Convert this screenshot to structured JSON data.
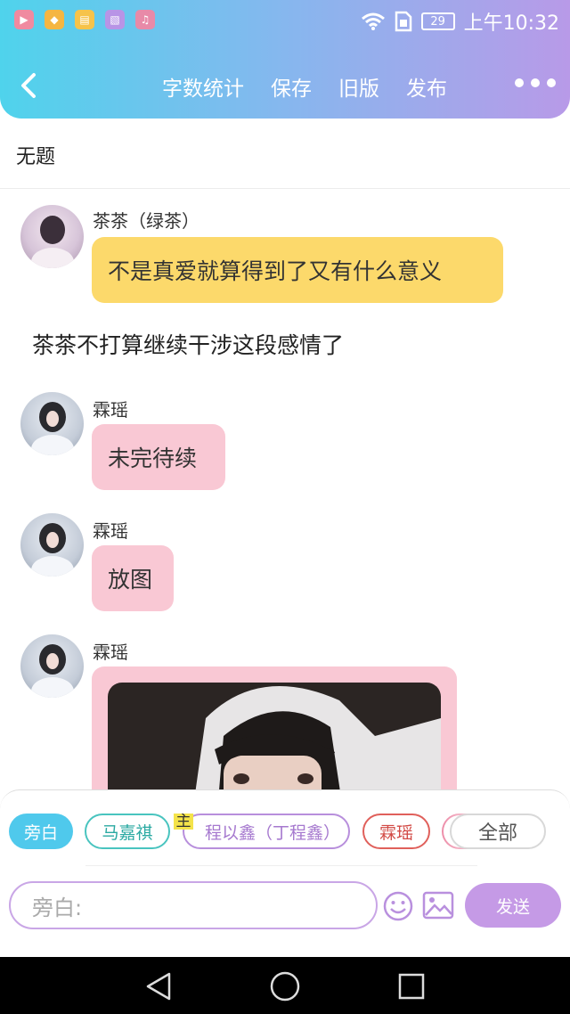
{
  "status": {
    "battery": "29",
    "time": "上午10:32"
  },
  "navbar": {
    "word_count": "字数统计",
    "save": "保存",
    "old_version": "旧版",
    "publish": "发布"
  },
  "doc": {
    "title": "无题"
  },
  "messages": [
    {
      "name": "茶茶（绿茶）",
      "text": "不是真爱就算得到了又有什么意义",
      "bubble_color": "#fcd96b"
    },
    {
      "narration": "茶茶不打算继续干涉这段感情了"
    },
    {
      "name": "霖瑶",
      "text": "未完待续",
      "bubble_color": "#f9c8d4"
    },
    {
      "name": "霖瑶",
      "text": "放图",
      "bubble_color": "#f9c8d4"
    },
    {
      "name": "霖瑶",
      "bubble_color": "#f9c8d4"
    }
  ],
  "roles": {
    "narrator": "旁白",
    "r1": "马嘉祺",
    "main_mark": "主",
    "r2": "程以鑫（丁程鑫）",
    "r3": "霖瑶",
    "all": "全部"
  },
  "input": {
    "placeholder": "旁白:",
    "send": "发送"
  },
  "colors": {
    "accent_purple": "#c59ae6",
    "teal": "#49c4bf",
    "red": "#e0605b",
    "cyan": "#4fc9ec"
  }
}
